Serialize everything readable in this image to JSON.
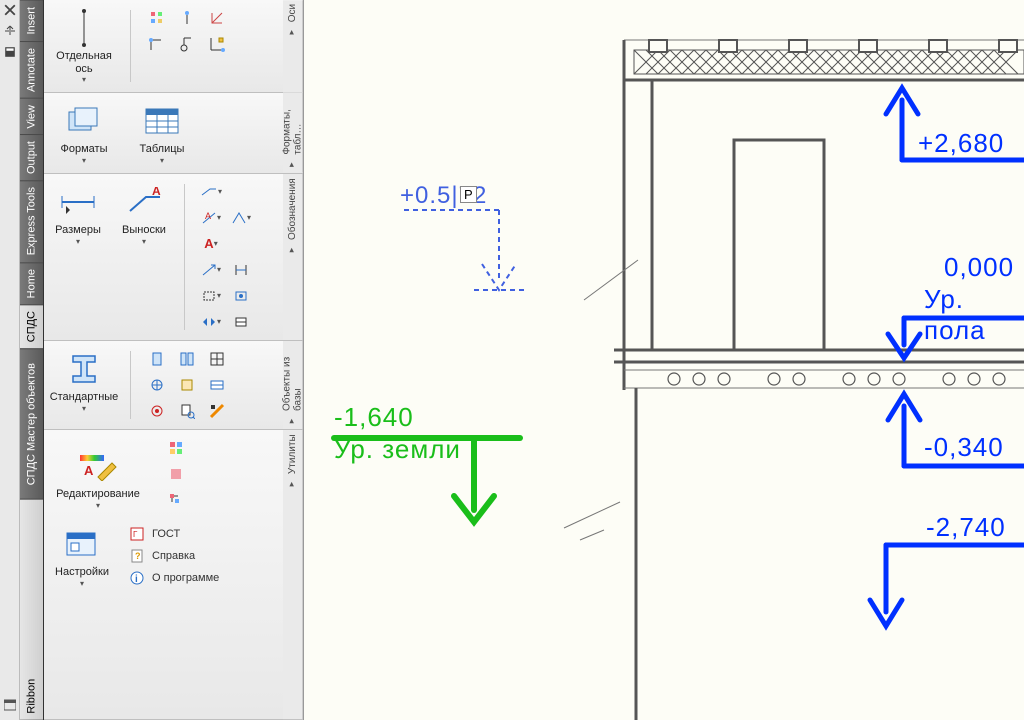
{
  "far_left": {
    "ribbon_label": "Ribbon"
  },
  "ribbon_tabs": {
    "insert": "Insert",
    "annotate": "Annotate",
    "view": "View",
    "output": "Output",
    "express": "Express Tools",
    "home": "Home",
    "spds": "СПДС",
    "spds_master": "СПДС Мастер объектов"
  },
  "panels": {
    "axes": {
      "single_axis": "Отдельная ось",
      "title": "Оси"
    },
    "formats": {
      "formats": "Форматы",
      "tables": "Таблицы",
      "title": "Форматы, табл…"
    },
    "dims": {
      "sizes": "Размеры",
      "leaders": "Выноски",
      "title": "Обозначения"
    },
    "db": {
      "standard": "Стандартные",
      "title": "Объекты из базы"
    },
    "utils": {
      "edit": "Редактирование",
      "gost": "ГОСТ",
      "help": "Справка",
      "about": "О программе",
      "settings": "Настройки",
      "title": "Утилиты"
    }
  },
  "drawing": {
    "edit_value": "+0.5|72",
    "edit_cursor": "P",
    "top_elev": "+2,680",
    "zero_elev": "0,000",
    "zero_label": "Ур. пола",
    "mid_elev": "-0,340",
    "bot_elev": "-2,740",
    "ground_elev": "-1,640",
    "ground_label": "Ур. земли"
  }
}
